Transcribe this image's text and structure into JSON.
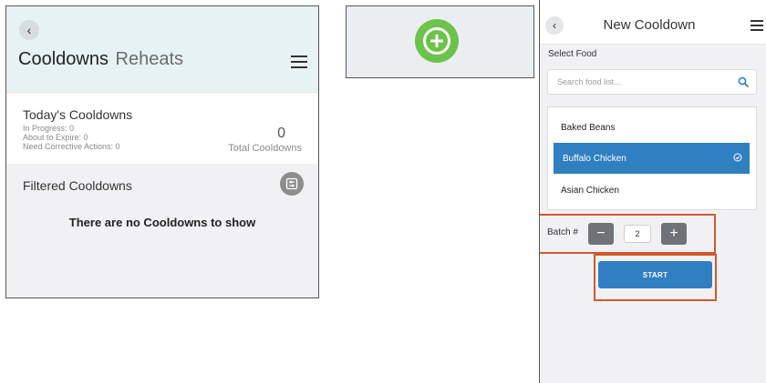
{
  "panel1": {
    "back_icon": "chevron-left-icon",
    "title_primary": "Cooldowns",
    "title_secondary": "Reheats",
    "menu_icon": "hamburger-menu-icon",
    "today": {
      "heading": "Today's Cooldowns",
      "in_progress": "In Progress: 0",
      "about_to_expire": "About to Expire: 0",
      "corrective": "Need Corrective Actions: 0",
      "total_value": "0",
      "total_label": "Total Cooldowns"
    },
    "filtered_heading": "Filtered Cooldowns",
    "filter_icon": "filter-icon",
    "empty_message": "There are no Cooldowns to show"
  },
  "panel2": {
    "add_icon": "plus-circle-icon",
    "add_color": "#6cc24a"
  },
  "panel3": {
    "back_icon": "chevron-left-icon",
    "title": "New Cooldown",
    "menu_icon": "hamburger-menu-icon",
    "select_label": "Select Food",
    "search_placeholder": "Search food list...",
    "search_icon": "search-icon",
    "foods": [
      {
        "label": "Baked Beans",
        "selected": false
      },
      {
        "label": "Buffalo Chicken",
        "selected": true
      },
      {
        "label": "Asian Chicken",
        "selected": false
      }
    ],
    "batch_label": "Batch #",
    "decrement": "−",
    "increment": "+",
    "batch_value": "2",
    "start_label": "START",
    "accent": "#2f7fc1",
    "highlight": "#d2582c"
  }
}
